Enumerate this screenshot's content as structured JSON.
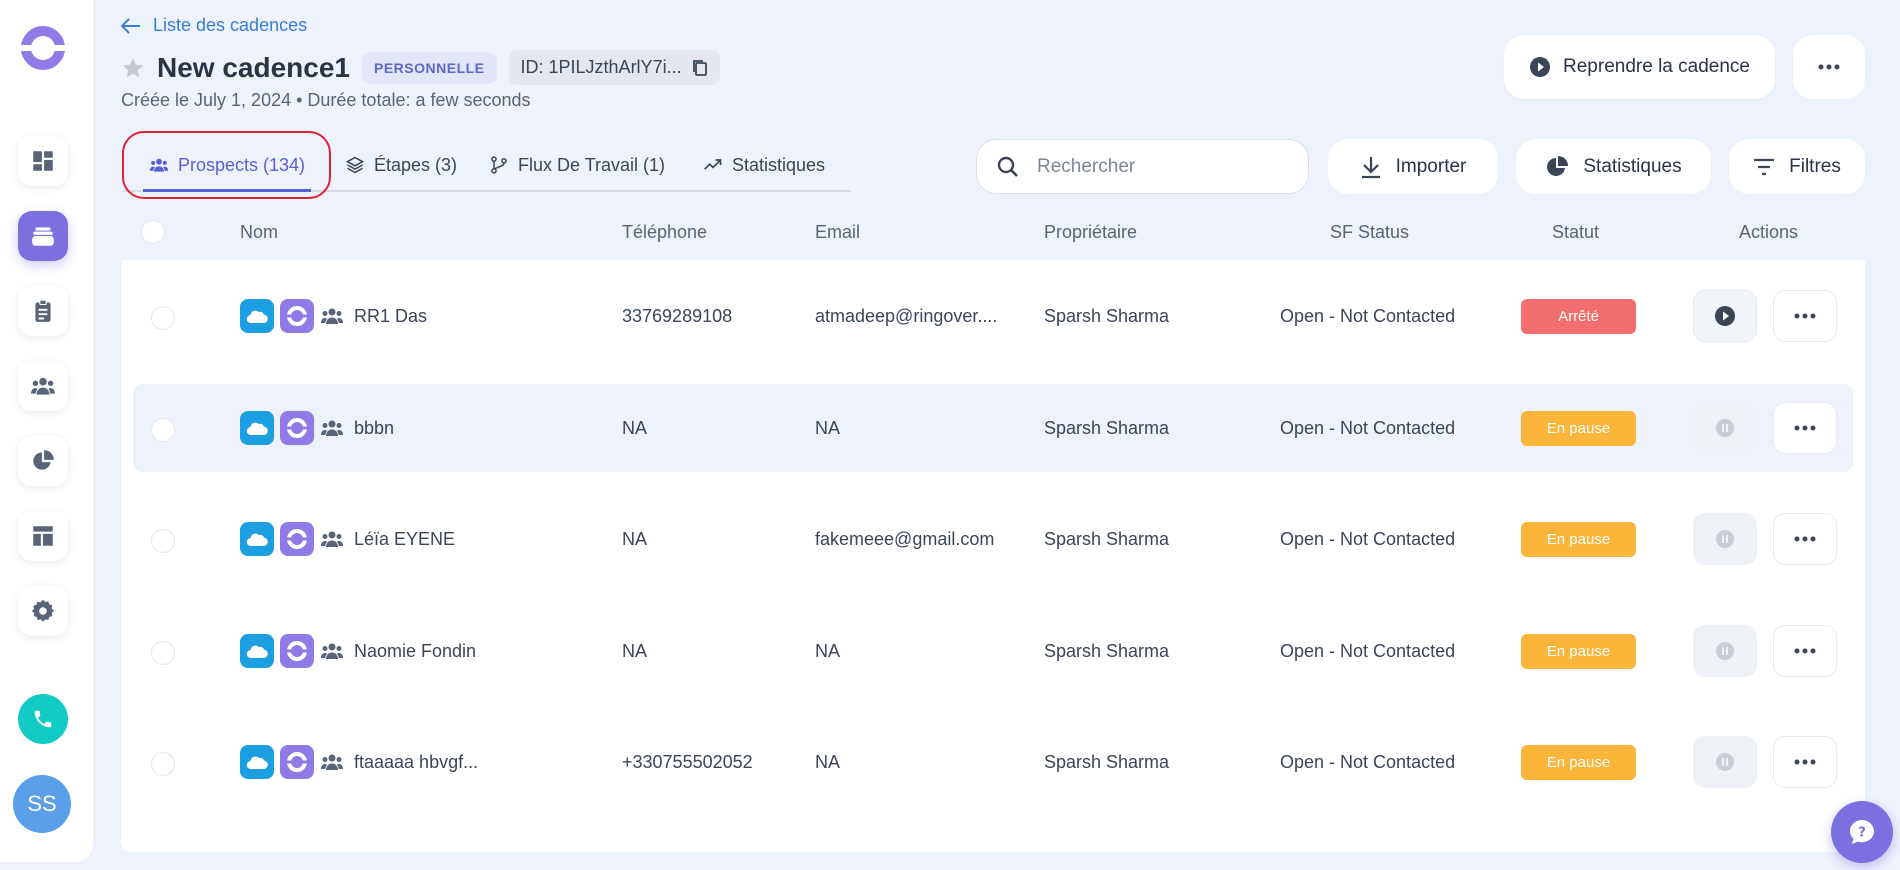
{
  "header": {
    "back_label": "Liste des cadences",
    "title": "New cadence1",
    "badge": "PERSONNELLE",
    "id_label": "ID: 1PILJzthArlY7i...",
    "subtitle": "Créée le July 1, 2024 • Durée totale: a few seconds",
    "resume_label": "Reprendre la cadence"
  },
  "tabs": [
    {
      "label": "Prospects (134)",
      "icon": "users-icon",
      "active": true
    },
    {
      "label": "Étapes (3)",
      "icon": "layers-icon"
    },
    {
      "label": "Flux De Travail (1)",
      "icon": "branch-icon"
    },
    {
      "label": "Statistiques",
      "icon": "trend-icon"
    }
  ],
  "toolbar": {
    "search_placeholder": "Rechercher",
    "import_label": "Importer",
    "stats_label": "Statistiques",
    "filters_label": "Filtres"
  },
  "table": {
    "columns": [
      "Nom",
      "Téléphone",
      "Email",
      "Propriétaire",
      "SF Status",
      "Statut",
      "Actions"
    ],
    "rows": [
      {
        "name": "RR1 Das",
        "phone": "33769289108",
        "email": "atmadeep@ringover....",
        "owner": "Sparsh Sharma",
        "sf_status": "Open - Not Contacted",
        "status": "Arrêté",
        "status_type": "stopped"
      },
      {
        "name": "bbbn",
        "phone": "NA",
        "email": "NA",
        "owner": "Sparsh Sharma",
        "sf_status": "Open - Not Contacted",
        "status": "En pause",
        "status_type": "paused"
      },
      {
        "name": "Léïa EYENE",
        "phone": "NA",
        "email": "fakemeee@gmail.com",
        "owner": "Sparsh Sharma",
        "sf_status": "Open - Not Contacted",
        "status": "En pause",
        "status_type": "paused"
      },
      {
        "name": "Naomie Fondin",
        "phone": "NA",
        "email": "NA",
        "owner": "Sparsh Sharma",
        "sf_status": "Open - Not Contacted",
        "status": "En pause",
        "status_type": "paused"
      },
      {
        "name": "ftaaaaa hbvgf...",
        "phone": "+330755502052",
        "email": "NA",
        "owner": "Sparsh Sharma",
        "sf_status": "Open - Not Contacted",
        "status": "En pause",
        "status_type": "paused"
      }
    ]
  },
  "user": {
    "initials": "SS"
  },
  "colors": {
    "accent": "#7c6fe0",
    "tab_active": "#5b5fd6",
    "stopped": "#f36e6e",
    "paused": "#fbb53a",
    "salesforce": "#1c9fe0",
    "phone": "#12cbc4"
  }
}
